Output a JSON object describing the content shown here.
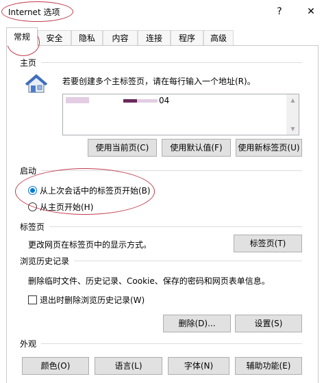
{
  "window": {
    "title": "Internet 选项",
    "help_glyph": "?",
    "close_glyph": "✕"
  },
  "tabs": [
    {
      "label": "常规",
      "active": true
    },
    {
      "label": "安全"
    },
    {
      "label": "隐私"
    },
    {
      "label": "内容"
    },
    {
      "label": "连接"
    },
    {
      "label": "程序"
    },
    {
      "label": "高级"
    }
  ],
  "homepage": {
    "group_label": "主页",
    "description": "若要创建多个主标签页，请在每行输入一个地址(R)。",
    "url_visible_suffix": "04",
    "btn_current": "使用当前页(C)",
    "btn_default": "使用默认值(F)",
    "btn_new_tab": "使用新标签页(U)"
  },
  "startup": {
    "group_label": "启动",
    "option_last_session": "从上次会话中的标签页开始(B)",
    "option_homepage": "从主页开始(H)",
    "selected": "last_session"
  },
  "tabs_section": {
    "group_label": "标签页",
    "description": "更改网页在标签页中的显示方式。",
    "button": "标签页(T)"
  },
  "history": {
    "group_label": "浏览历史记录",
    "description": "删除临时文件、历史记录、Cookie、保存的密码和网页表单信息。",
    "checkbox_label": "退出时删除浏览历史记录(W)",
    "checkbox_checked": false,
    "btn_delete": "删除(D)...",
    "btn_settings": "设置(S)"
  },
  "appearance": {
    "group_label": "外观",
    "btn_colors": "颜色(O)",
    "btn_languages": "语言(L)",
    "btn_fonts": "字体(N)",
    "btn_accessibility": "辅助功能(E)"
  },
  "colors": {
    "accent": "#0078d7",
    "annotation": "#c0394b",
    "button_face": "#e1e1e1",
    "border": "#adadad"
  }
}
